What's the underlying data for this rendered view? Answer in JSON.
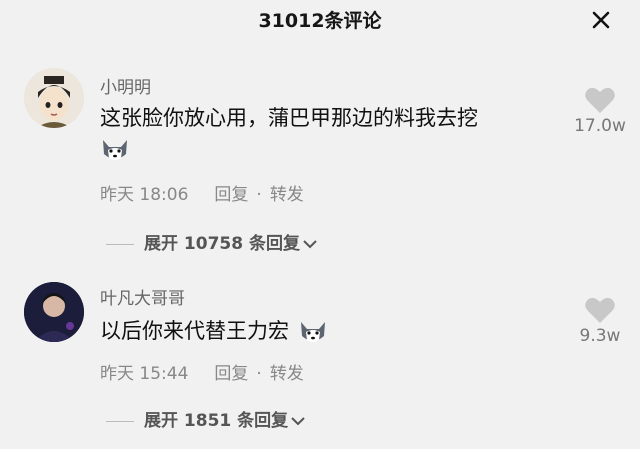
{
  "header": {
    "title": "31012条评论"
  },
  "comments": [
    {
      "username": "小明明",
      "text": "这张脸你放心用，蒲巴甲那边的料我去挖",
      "time": "昨天 18:06",
      "reply_label": "回复",
      "separator": "·",
      "forward_label": "转发",
      "likes": "17.0w",
      "expand_label": "展开 10758 条回复"
    },
    {
      "username": "叶凡大哥哥",
      "text": "以后你来代替王力宏",
      "time": "昨天 15:44",
      "reply_label": "回复",
      "separator": "·",
      "forward_label": "转发",
      "likes": "9.3w",
      "expand_label": "展开 1851 条回复"
    }
  ],
  "icons": {
    "close": "close-icon",
    "like": "heart-icon",
    "emoji": "husky-emoji-icon",
    "expand": "chevron-down-icon"
  },
  "colors": {
    "background": "#f1f1f1",
    "muted": "#888888",
    "text": "#111111"
  }
}
